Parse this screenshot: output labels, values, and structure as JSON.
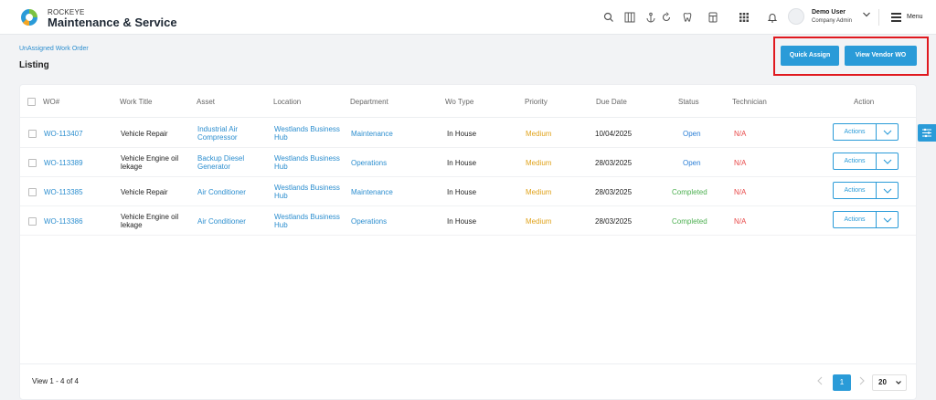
{
  "header": {
    "brand_top": "ROCKEYE",
    "brand_main": "Maintenance & Service",
    "icons": [
      "search-icon",
      "columns-icon",
      "anchor-icon",
      "refresh-icon",
      "tooth-icon",
      "calculator-icon",
      "apps-grid-icon",
      "bell-icon"
    ],
    "user": {
      "name": "Demo User",
      "role": "Company Admin"
    },
    "menu_label": "Menu"
  },
  "subheader": {
    "breadcrumb": "UnAssigned Work Order",
    "title": "Listing",
    "quick_assign": "Quick Assign",
    "view_vendor_wo": "View Vendor WO"
  },
  "table": {
    "columns": [
      "WO#",
      "Work Title",
      "Asset",
      "Location",
      "Department",
      "Wo Type",
      "Priority",
      "Due Date",
      "Status",
      "Technician",
      "Action"
    ],
    "rows": [
      {
        "wo": "WO-113407",
        "title": "Vehicle Repair",
        "asset": "Industrial Air Compressor",
        "location": "Westlands Business Hub",
        "department": "Maintenance",
        "wo_type": "In House",
        "priority": "Medium",
        "due_date": "10/04/2025",
        "status": "Open",
        "technician": "N/A",
        "action": "Actions"
      },
      {
        "wo": "WO-113389",
        "title": "Vehicle Engine oil lekage",
        "asset": "Backup Diesel Generator",
        "location": "Westlands Business Hub",
        "department": "Operations",
        "wo_type": "In House",
        "priority": "Medium",
        "due_date": "28/03/2025",
        "status": "Open",
        "technician": "N/A",
        "action": "Actions"
      },
      {
        "wo": "WO-113385",
        "title": "Vehicle Repair",
        "asset": "Air Conditioner",
        "location": "Westlands Business Hub",
        "department": "Maintenance",
        "wo_type": "In House",
        "priority": "Medium",
        "due_date": "28/03/2025",
        "status": "Completed",
        "technician": "N/A",
        "action": "Actions"
      },
      {
        "wo": "WO-113386",
        "title": "Vehicle Engine oil lekage",
        "asset": "Air Conditioner",
        "location": "Westlands Business Hub",
        "department": "Operations",
        "wo_type": "In House",
        "priority": "Medium",
        "due_date": "28/03/2025",
        "status": "Completed",
        "technician": "N/A",
        "action": "Actions"
      }
    ]
  },
  "footer": {
    "view_count": "View 1 - 4 of 4",
    "current_page": "1",
    "page_size": "20"
  },
  "colors": {
    "accent": "#2a9bd8",
    "highlight_border": "#e0191f",
    "priority_medium": "#e0a31c",
    "status_open": "#2c7fd6",
    "status_completed": "#4caf50",
    "technician_na": "#e84a4a"
  }
}
